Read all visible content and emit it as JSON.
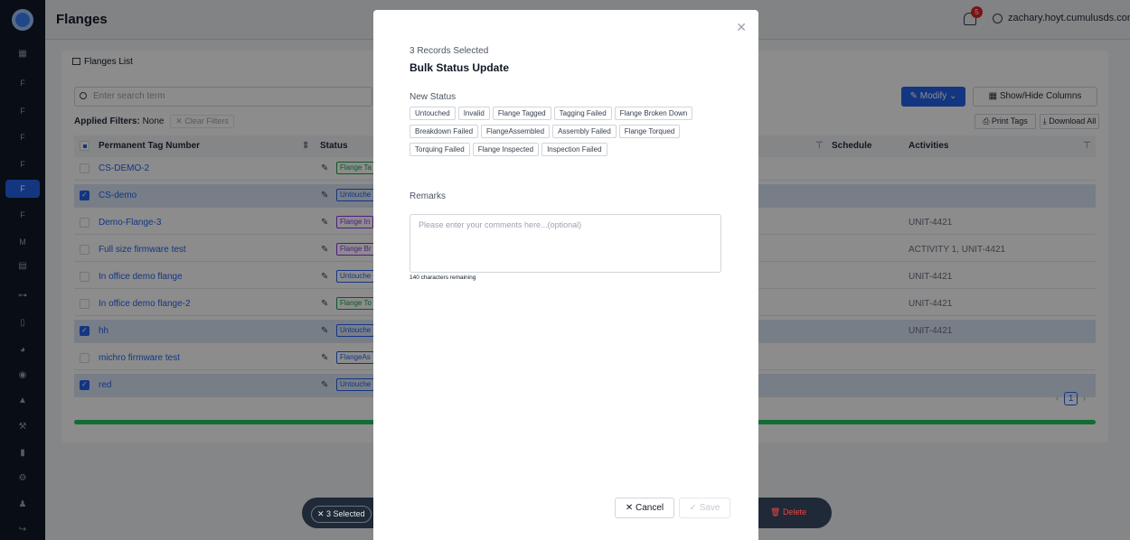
{
  "header": {
    "title": "Flanges",
    "notification_count": "5",
    "user_email": "zachary.hoyt.cumulusds.com"
  },
  "sidebar": {
    "letters": [
      "F",
      "F",
      "F",
      "F",
      "F",
      "F",
      "M"
    ]
  },
  "card": {
    "title": "Flanges List",
    "search_placeholder": "Enter search term",
    "applied_filters_label": "Applied Filters:",
    "applied_filters_value": "None",
    "clear_filters": "Clear Filters",
    "modify": "Modify",
    "show_hide": "Show/Hide Columns",
    "print_tags": "Print Tags",
    "download_all": "Download All"
  },
  "table": {
    "columns": [
      "Permanent Tag Number",
      "Status",
      "Schedule",
      "Activities"
    ],
    "rows": [
      {
        "name": "CS-DEMO-2",
        "status": "Flange Ta",
        "status_color": "#16a34a",
        "activity": "",
        "selected": false
      },
      {
        "name": "CS-demo",
        "status": "Untouche",
        "status_color": "#2563eb",
        "activity": "",
        "selected": true
      },
      {
        "name": "Demo-Flange-3",
        "status": "Flange In",
        "status_color": "#9333ea",
        "activity": "UNIT-4421",
        "selected": false
      },
      {
        "name": "Full size firmware test",
        "status": "Flange Br",
        "status_color": "#9333ea",
        "activity": "ACTIVITY 1, UNIT-4421",
        "selected": false
      },
      {
        "name": "In office demo flange",
        "status": "Untouche",
        "status_color": "#2563eb",
        "activity": "UNIT-4421",
        "selected": false
      },
      {
        "name": "In office demo flange-2",
        "status": "Flange To",
        "status_color": "#16a34a",
        "activity": "UNIT-4421",
        "selected": false
      },
      {
        "name": "hh",
        "status": "Untouche",
        "status_color": "#2563eb",
        "activity": "UNIT-4421",
        "selected": true
      },
      {
        "name": "michro firmware test",
        "status": "FlangeAs",
        "status_color": "#2563eb",
        "activity": "",
        "selected": false
      },
      {
        "name": "red",
        "status": "Untouche",
        "status_color": "#2563eb",
        "activity": "",
        "selected": true
      }
    ]
  },
  "pagination": {
    "current_page": "1"
  },
  "bottom_bar": {
    "selected": "3 Selected",
    "delete": "Delete"
  },
  "modal": {
    "subtitle": "3 Records Selected",
    "title": "Bulk Status Update",
    "new_status_label": "New Status",
    "statuses": [
      "Untouched",
      "Invalid",
      "Flange Tagged",
      "Tagging Failed",
      "Flange Broken Down",
      "Breakdown Failed",
      "FlangeAssembled",
      "Assembly Failed",
      "Flange Torqued",
      "Torquing Failed",
      "Flange Inspected",
      "Inspection Failed"
    ],
    "remarks_label": "Remarks",
    "remarks_placeholder": "Please enter your comments here...(optional)",
    "chars_remaining": "140 characters remaining",
    "cancel": "Cancel",
    "save": "Save"
  }
}
